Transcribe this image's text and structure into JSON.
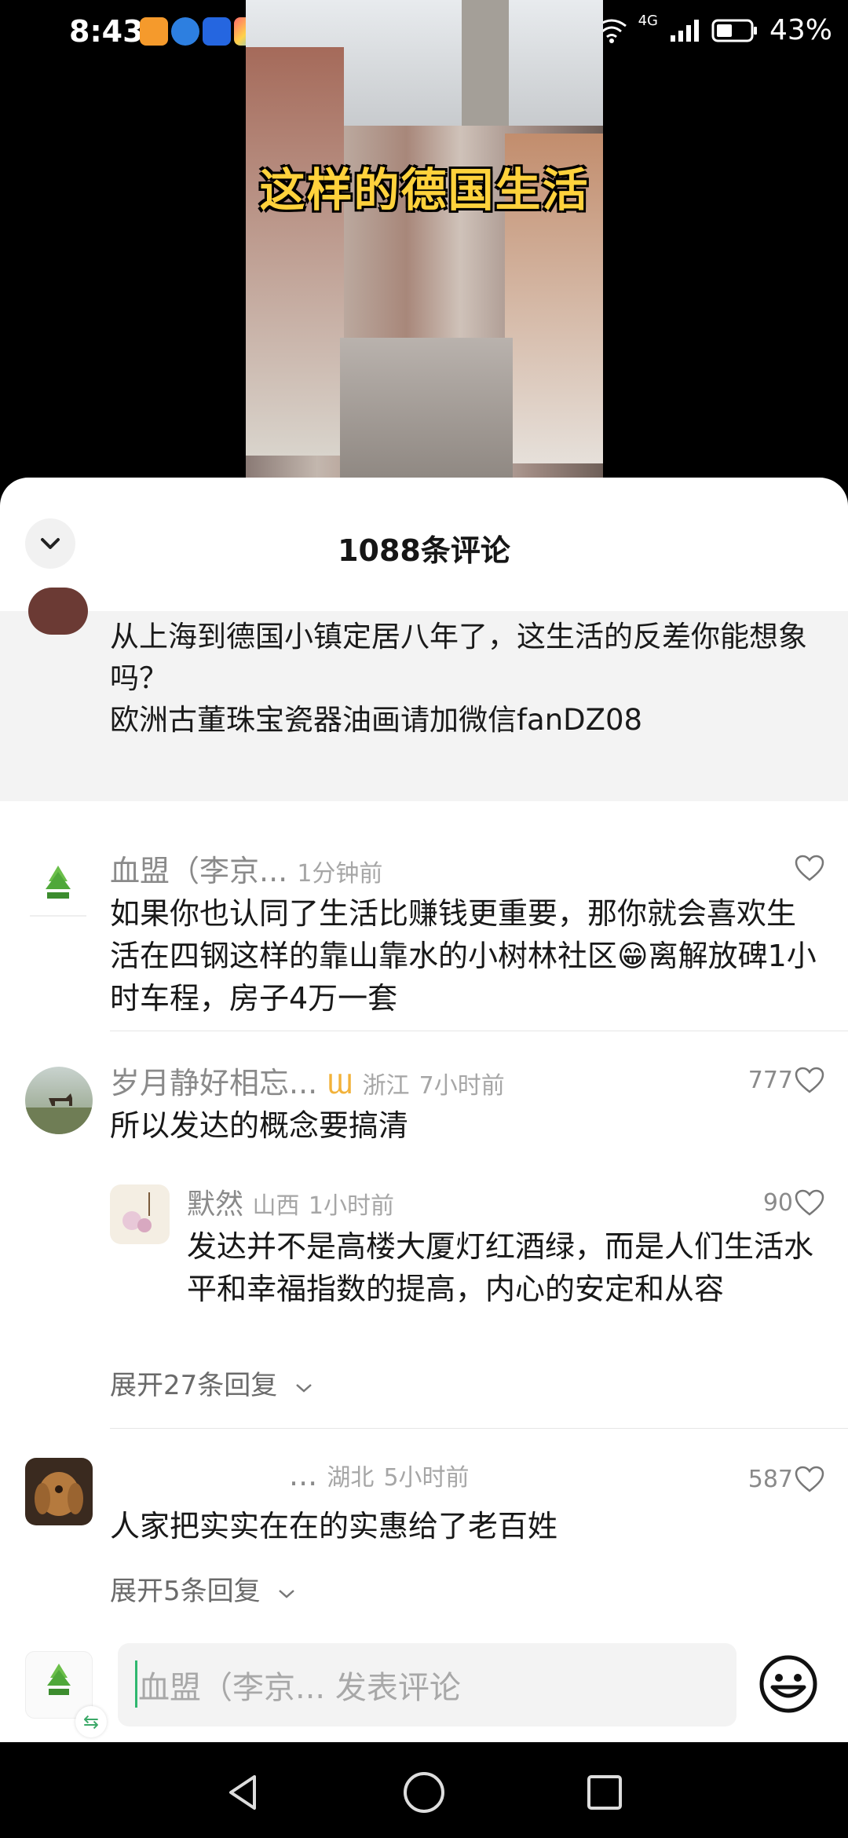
{
  "status_bar": {
    "time": "8:43",
    "battery_percent": "43%",
    "network": "4G"
  },
  "video": {
    "title_overlay": "这样的德国生活"
  },
  "sheet": {
    "comments_count": "1088条评论"
  },
  "pinned_comment": {
    "text": "从上海到德国小镇定居八年了，这生活的反差你能想象吗？\n欧洲古董珠宝瓷器油画请加微信fanDZ08"
  },
  "comments": [
    {
      "name": "血盟（李京...",
      "time": "1分钟前",
      "location": "",
      "likes": "",
      "text": "如果你也认同了生活比赚钱更重要，那你就会喜欢生活在四钢这样的靠山靠水的小树林社区😁离解放碑1小时车程，房子4万一套"
    },
    {
      "name": "岁月静好相忘...",
      "badge": "Ɯ",
      "location": "浙江",
      "time": "7小时前",
      "likes": "777",
      "text": "所以发达的概念要搞清",
      "reply": {
        "name": "默然",
        "location": "山西",
        "time": "1小时前",
        "likes": "90",
        "text": "发达并不是高楼大厦灯红酒绿，而是人们生活水平和幸福指数的提高，内心的安定和从容"
      },
      "expand": "展开27条回复"
    },
    {
      "name": "...",
      "location": "湖北",
      "time": "5小时前",
      "likes": "587",
      "text": "人家把实实在在的实惠给了老百姓",
      "expand": "展开5条回复"
    }
  ],
  "input": {
    "placeholder": "血盟（李京... 发表评论"
  },
  "colors": {
    "accent_green": "#2fb76f",
    "title_yellow": "#ffd23c"
  }
}
